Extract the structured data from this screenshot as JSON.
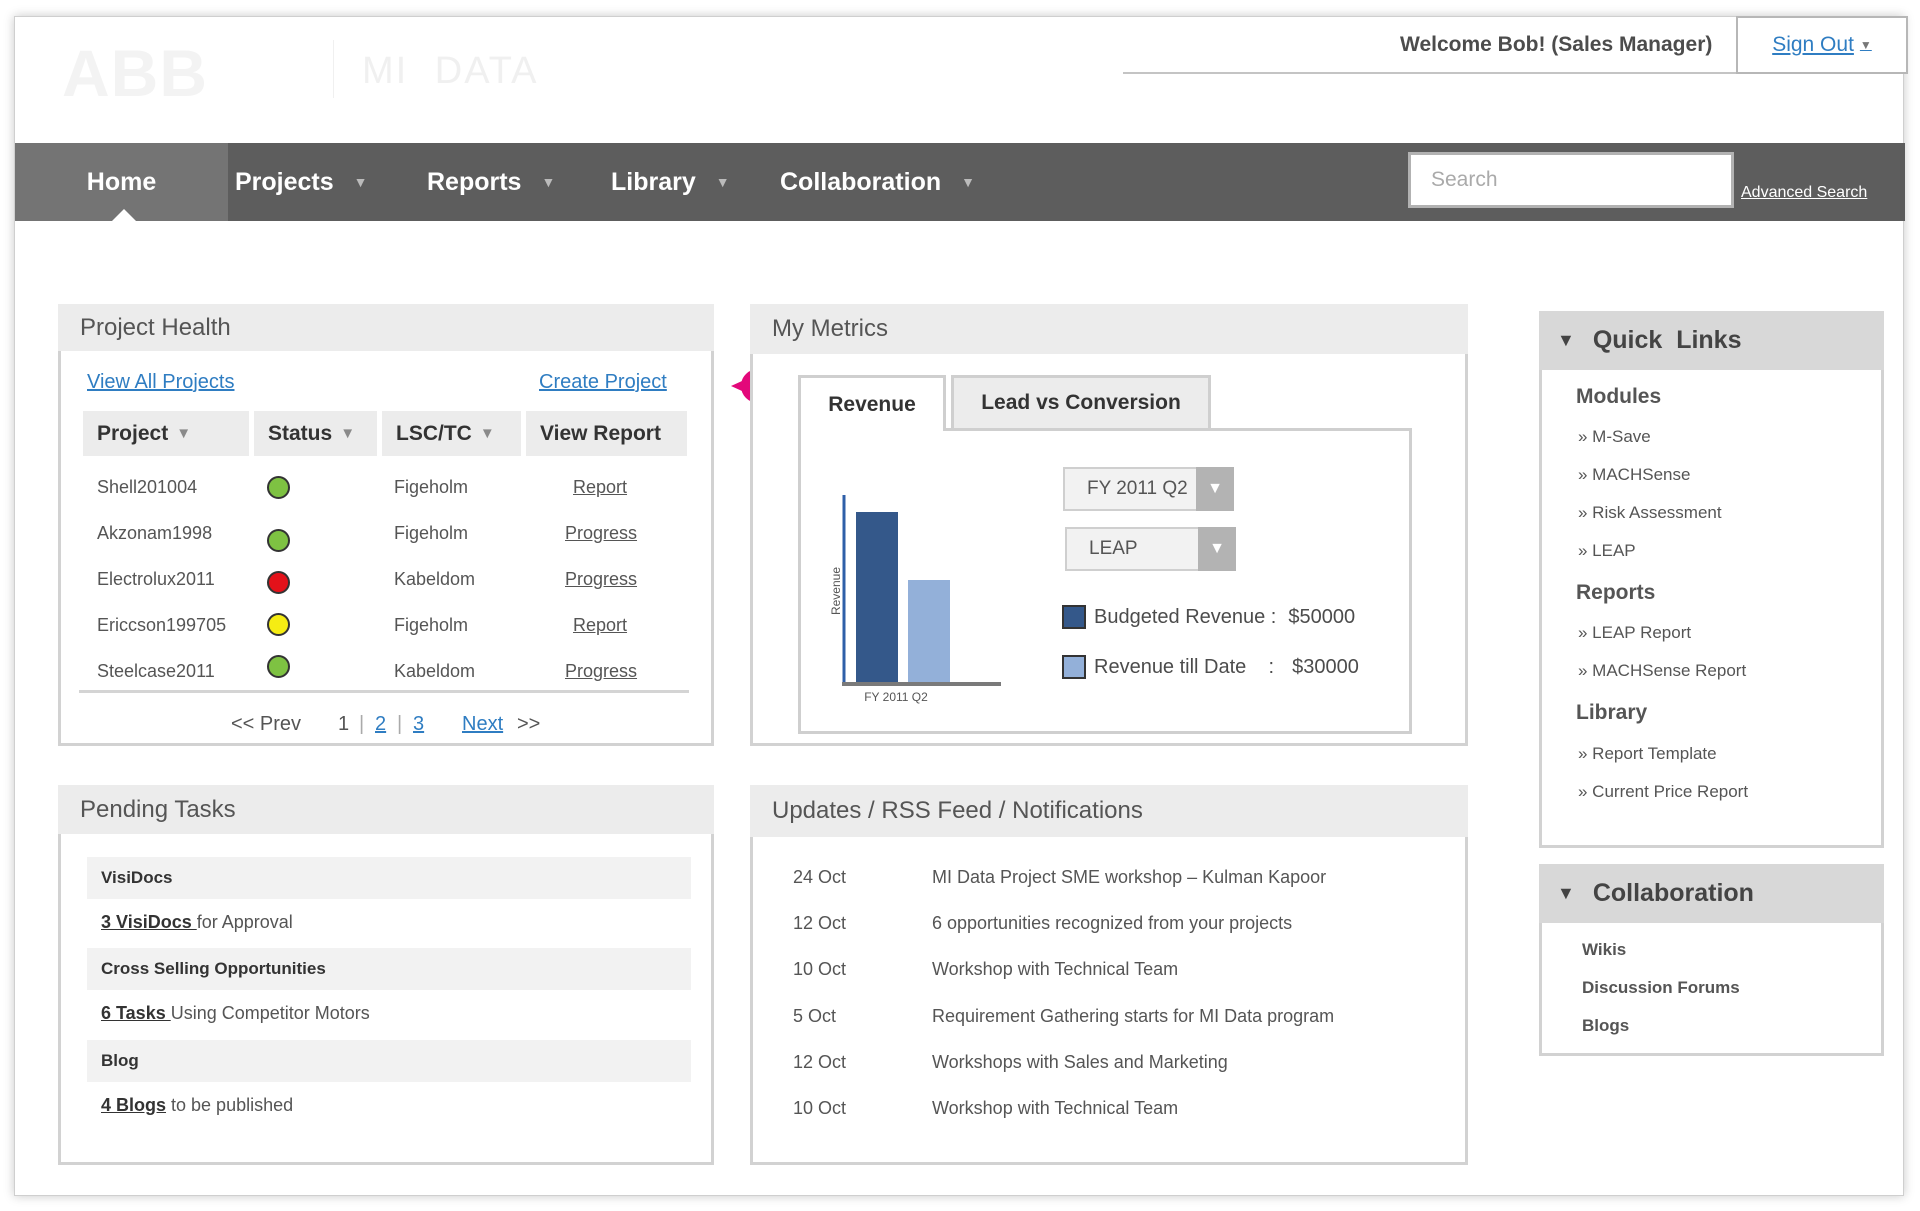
{
  "header": {
    "logo": "ABB",
    "product": "MI DATA",
    "welcome": "Welcome Bob!  (Sales Manager)",
    "sign_out": "Sign Out"
  },
  "nav": {
    "items": [
      "Home",
      "Projects",
      "Reports",
      "Library",
      "Collaboration"
    ],
    "active": "Home",
    "search_placeholder": "Search",
    "advanced_search": "Advanced Search"
  },
  "project_health": {
    "title": "Project Health",
    "view_all": "View All Projects",
    "create": "Create Project",
    "columns": [
      "Project",
      "Status",
      "LSC/TC",
      "View Report"
    ],
    "rows": [
      {
        "project": "Shell201004",
        "status": "green",
        "lsc": "Figeholm",
        "report": "Report"
      },
      {
        "project": "Akzonam1998",
        "status": "green",
        "lsc": "Figeholm",
        "report": "Progress"
      },
      {
        "project": "Electrolux2011",
        "status": "red",
        "lsc": "Kabeldom",
        "report": "Progress"
      },
      {
        "project": "Ericcson199705",
        "status": "yellow",
        "lsc": "Figeholm",
        "report": "Report"
      },
      {
        "project": "Steelcase2011",
        "status": "green",
        "lsc": "Kabeldom",
        "report": "Progress"
      }
    ],
    "pagination": {
      "prev": "<<  Prev",
      "p1": "1",
      "p2": "2",
      "p3": "3",
      "next": "Next",
      "next_arrow": ">>"
    }
  },
  "metrics": {
    "title": "My Metrics",
    "tabs": [
      "Revenue",
      "Lead vs Conversion"
    ],
    "period_select": "FY 2011 Q2",
    "module_select": "LEAP",
    "legend": {
      "budgeted_label": "Budgeted Revenue :",
      "budgeted_value": "$50000",
      "till_date_label": "Revenue till Date    :",
      "till_date_value": "$30000"
    }
  },
  "chart_data": {
    "type": "bar",
    "categories": [
      "FY 2011 Q2"
    ],
    "series": [
      {
        "name": "Budgeted Revenue",
        "values": [
          50000
        ]
      },
      {
        "name": "Revenue till Date",
        "values": [
          30000
        ]
      }
    ],
    "xlabel": "",
    "ylabel": "Revenue",
    "ylim": [
      0,
      55000
    ],
    "colors": [
      "#34588a",
      "#93b0d9"
    ]
  },
  "pending": {
    "title": "Pending Tasks",
    "sections": [
      {
        "heading": "VisiDocs",
        "link": "3 VisiDocs ",
        "text": "for Approval"
      },
      {
        "heading": "Cross Selling Opportunities",
        "link": "6 Tasks ",
        "text": "Using Competitor Motors"
      },
      {
        "heading": "Blog",
        "link": "4 Blogs",
        "text": " to be published"
      }
    ]
  },
  "feed": {
    "title": "Updates / RSS Feed / Notifications",
    "items": [
      {
        "date": "24 Oct",
        "text": "MI Data Project SME workshop – Kulman Kapoor"
      },
      {
        "date": "12 Oct",
        "text": "6 opportunities recognized from your projects"
      },
      {
        "date": "10 Oct",
        "text": "Workshop with Technical Team"
      },
      {
        "date": "5 Oct",
        "text": "Requirement Gathering starts for MI Data program"
      },
      {
        "date": "12 Oct",
        "text": "Workshops with Sales and Marketing"
      },
      {
        "date": "10 Oct",
        "text": "Workshop with Technical Team"
      }
    ]
  },
  "quick_links": {
    "title": "Quick  Links",
    "modules_title": "Modules",
    "modules": [
      "» M-Save",
      "» MACHSense",
      "» Risk Assessment",
      "» LEAP"
    ],
    "reports_title": "Reports",
    "reports": [
      "» LEAP Report",
      "» MACHSense Report"
    ],
    "library_title": "Library",
    "library": [
      "» Report Template",
      "» Current Price Report"
    ]
  },
  "collaboration": {
    "title": "Collaboration",
    "items": [
      "Wikis",
      "Discussion Forums",
      "Blogs"
    ]
  },
  "status_colors": {
    "green": "#7ec242",
    "red": "#e3121a",
    "yellow": "#f5ec13"
  }
}
